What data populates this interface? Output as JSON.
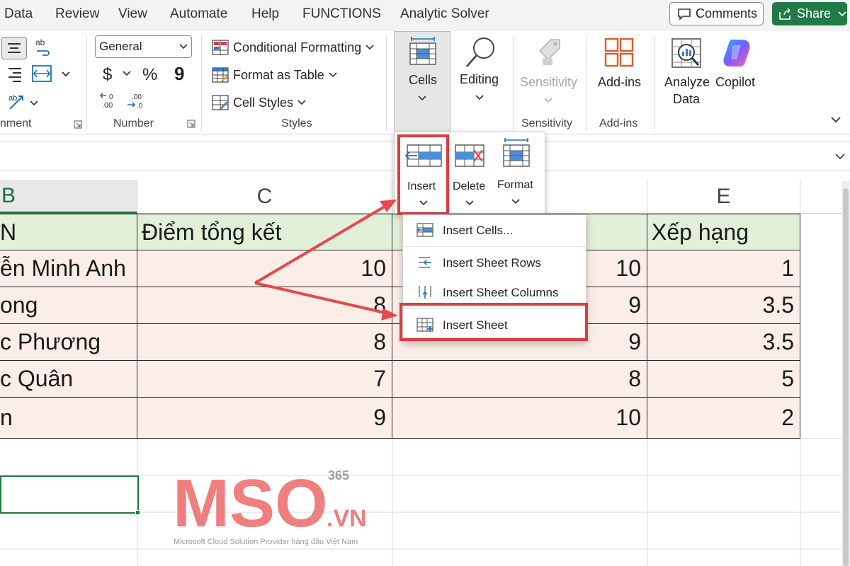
{
  "menu": {
    "tabs": [
      "Data",
      "Review",
      "View",
      "Automate",
      "Help",
      "FUNCTIONS",
      "Analytic Solver"
    ],
    "comments_label": "Comments",
    "share_label": "Share"
  },
  "ribbon": {
    "number": {
      "format_value": "General",
      "currency_symbol": "$",
      "percent_symbol": "%",
      "comma_symbol": "9",
      "group_label": "Number"
    },
    "alignment": {
      "group_label": "nment"
    },
    "styles": {
      "conditional_formatting": "Conditional Formatting",
      "format_as_table": "Format as Table",
      "cell_styles": "Cell Styles",
      "group_label": "Styles"
    },
    "cells": {
      "label": "Cells"
    },
    "editing": {
      "label": "Editing"
    },
    "sensitivity": {
      "label": "Sensitivity",
      "group_label": "Sensitivity"
    },
    "addins": {
      "label": "Add-ins",
      "group_label": "Add-ins"
    },
    "analyze": {
      "label_line1": "Analyze",
      "label_line2": "Data"
    },
    "copilot": {
      "label": "Copilot"
    }
  },
  "cells_dropdown": {
    "insert_label": "Insert",
    "delete_label": "Delete",
    "format_label": "Format"
  },
  "insert_menu": {
    "items": [
      "Insert Cells...",
      "Insert Sheet Rows",
      "Insert Sheet Columns",
      "Insert Sheet"
    ]
  },
  "grid": {
    "column_headers": [
      "B",
      "C",
      "E"
    ],
    "header_row": {
      "b": "N",
      "c": "Điểm tổng kết",
      "d": "",
      "e": "Xếp hạng"
    },
    "rows": [
      {
        "b": "ễn Minh Anh",
        "c": "10",
        "d": "10",
        "e": "1"
      },
      {
        "b": "ong",
        "c": "8",
        "d": "9",
        "e": "3.5"
      },
      {
        "b": "c Phương",
        "c": "8",
        "d": "9",
        "e": "3.5"
      },
      {
        "b": "c Quân",
        "c": "7",
        "d": "8",
        "e": "5"
      },
      {
        "b": "n",
        "c": "9",
        "d": "10",
        "e": "2"
      }
    ]
  },
  "watermark": {
    "superscript": "365",
    "logo_text": "MSO",
    "domain": ".VN",
    "tagline": "Microsoft Cloud Solution Provider hàng đầu Việt Nam"
  },
  "colors": {
    "share_green": "#1f7a45",
    "header_fill": "#e2efd9",
    "row_fill": "#fbeee9",
    "highlight_red": "#e03a3e",
    "arrow_red": "#e8474c",
    "watermark_pink": "#ef7e7e"
  }
}
